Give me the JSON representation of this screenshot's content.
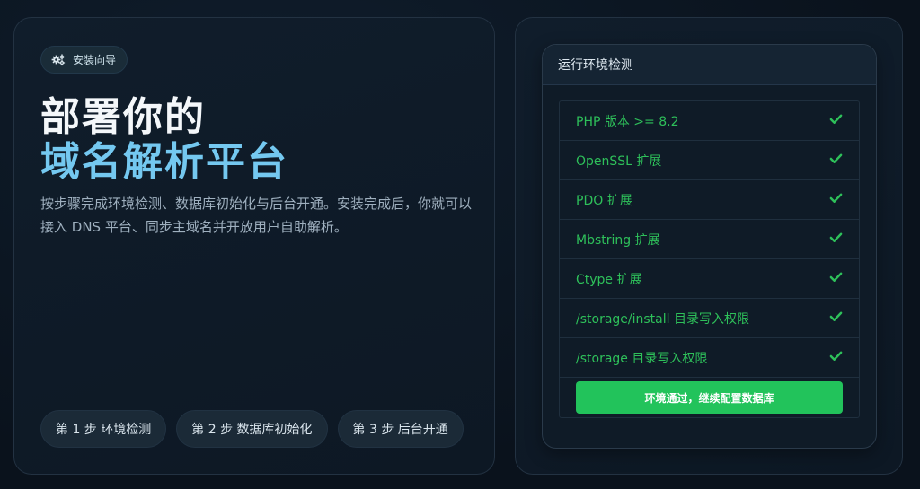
{
  "badge": {
    "label": "安装向导",
    "icon": "gears-icon"
  },
  "hero": {
    "line1": "部署你的",
    "line2": "域名解析平台"
  },
  "description": "按步骤完成环境检测、数据库初始化与后台开通。安装完成后，你就可以接入 DNS 平台、同步主域名并开放用户自助解析。",
  "steps": [
    {
      "label": "第 1 步 环境检测"
    },
    {
      "label": "第 2 步 数据库初始化"
    },
    {
      "label": "第 3 步 后台开通"
    }
  ],
  "check": {
    "title": "运行环境检测",
    "items": [
      {
        "label": "PHP 版本 >= 8.2",
        "status": "pass"
      },
      {
        "label": "OpenSSL 扩展",
        "status": "pass"
      },
      {
        "label": "PDO 扩展",
        "status": "pass"
      },
      {
        "label": "Mbstring 扩展",
        "status": "pass"
      },
      {
        "label": "Ctype 扩展",
        "status": "pass"
      },
      {
        "label": "/storage/install 目录写入权限",
        "status": "pass"
      },
      {
        "label": "/storage 目录写入权限",
        "status": "pass"
      }
    ],
    "continue_label": "环境通过，继续配置数据库"
  },
  "colors": {
    "accent_green": "#22c35b",
    "hero_blue": "#74c8f0",
    "background": "#0b1420"
  }
}
